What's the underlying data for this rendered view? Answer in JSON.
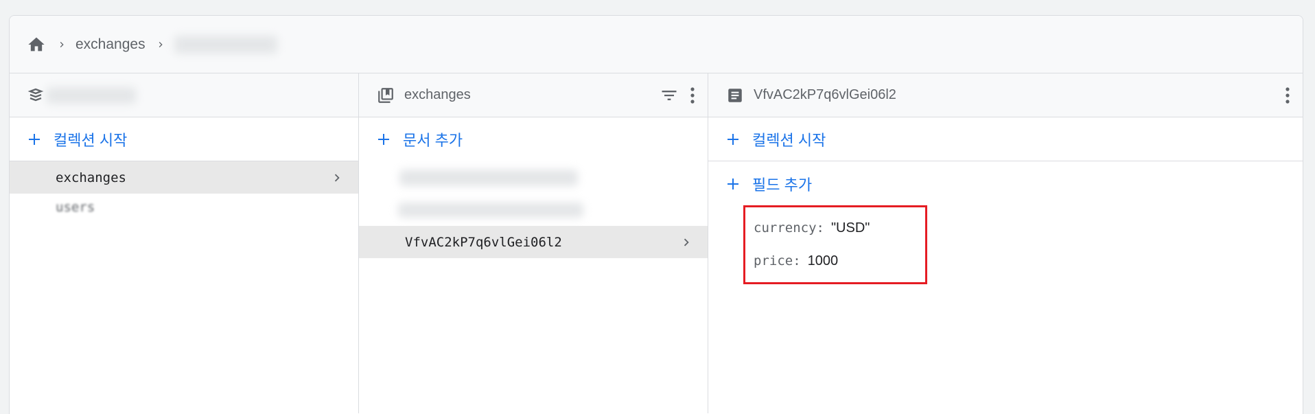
{
  "breadcrumb": {
    "items": [
      "exchanges"
    ]
  },
  "panel1": {
    "add_label": "컬렉션 시작",
    "items": [
      {
        "label": "exchanges",
        "selected": true
      },
      {
        "label": "users",
        "selected": false
      }
    ]
  },
  "panel2": {
    "title": "exchanges",
    "add_label": "문서 추가",
    "items": [
      {
        "label": "VfvAC2kP7q6vlGei06l2",
        "selected": true
      }
    ]
  },
  "panel3": {
    "title": "VfvAC2kP7q6vlGei06l2",
    "add_collection_label": "컬렉션 시작",
    "add_field_label": "필드 추가",
    "fields": [
      {
        "key": "currency:",
        "value": "\"USD\""
      },
      {
        "key": "price:",
        "value": "1000"
      }
    ]
  },
  "colors": {
    "accent": "#1a73e8",
    "highlight_border": "#e51c23",
    "selected_bg": "#e8e8e8"
  },
  "icons": [
    "home-icon",
    "chevron-right-icon",
    "database-icon",
    "collection-icon",
    "filter-icon",
    "more-vert-icon",
    "document-icon",
    "plus-icon"
  ]
}
